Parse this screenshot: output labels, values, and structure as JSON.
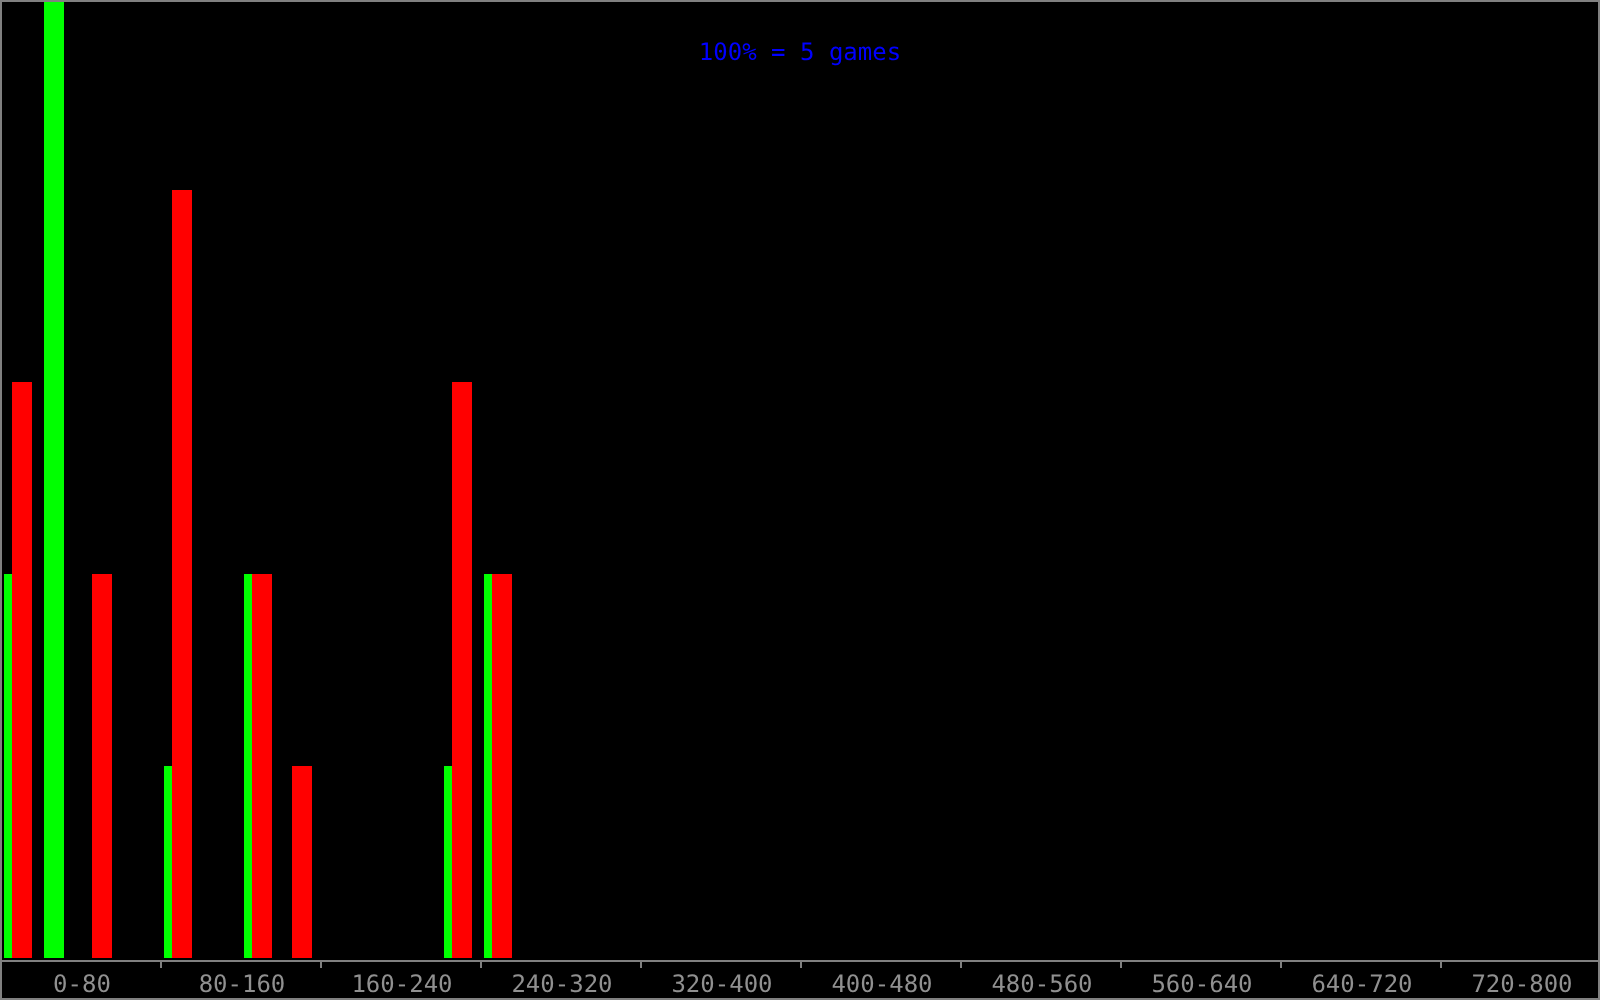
{
  "chart": {
    "title": "100% = 5 games",
    "axis_labels": [
      "0-80",
      "80-160",
      "160-240",
      "240-320",
      "320-400",
      "400-480",
      "480-560",
      "560-640",
      "640-720",
      "720-800"
    ]
  }
}
